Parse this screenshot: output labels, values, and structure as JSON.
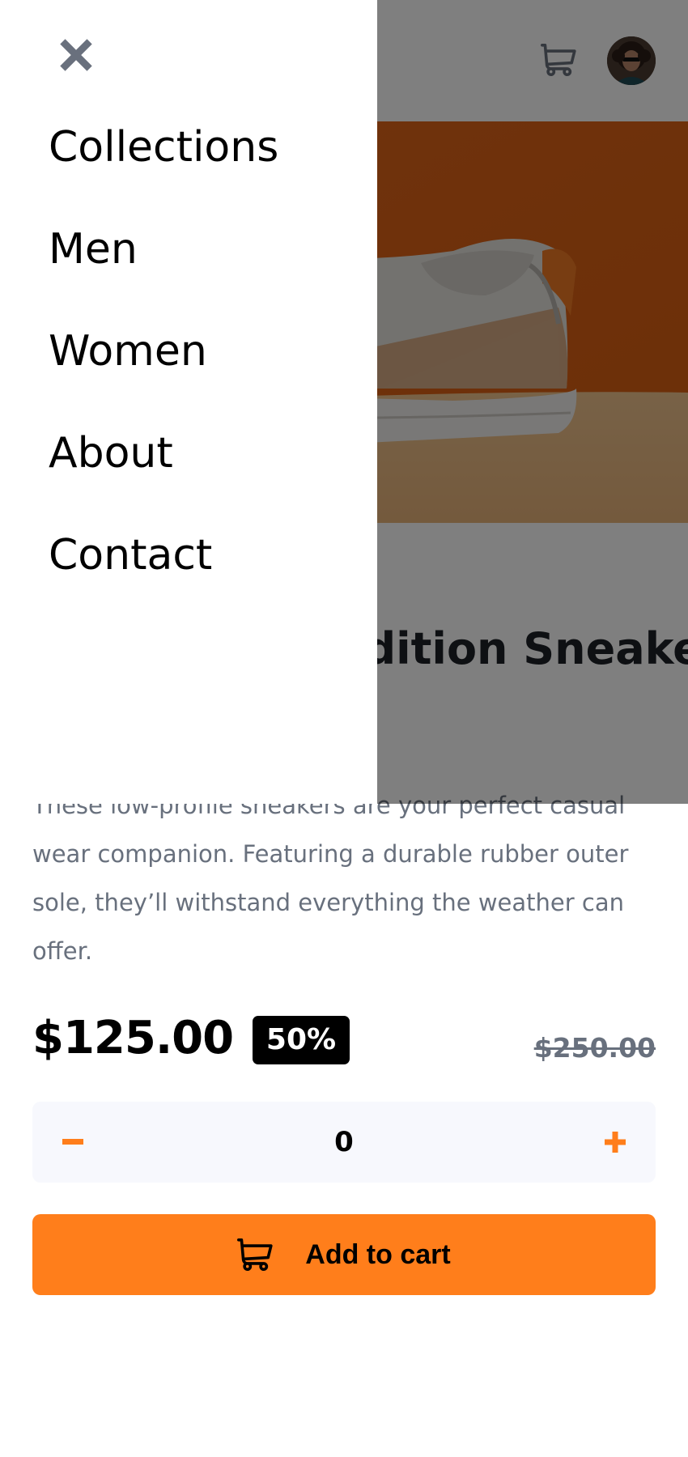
{
  "header": {
    "cart_icon": "cart-icon",
    "avatar_icon": "user-avatar"
  },
  "product": {
    "title": "Fall Limited Edition Sneakers",
    "description": "These low-profile sneakers are your perfect casual wear companion. Featuring a durable rubber outer sole, they’ll withstand everything the weather can offer.",
    "price": "$125.00",
    "discount": "50%",
    "original_price": "$250.00",
    "image_icon": "sneaker-photo"
  },
  "quantity": {
    "value": "0",
    "minus_icon": "minus-icon",
    "plus_icon": "plus-icon"
  },
  "add_to_cart": {
    "label": "Add to cart",
    "icon": "cart-icon"
  },
  "menu": {
    "close_icon": "close-icon",
    "items": [
      "Collections",
      "Men",
      "Women",
      "About",
      "Contact"
    ]
  },
  "colors": {
    "accent": "#ff7e1b",
    "text_dark": "#1d2026",
    "text_muted": "#68707d",
    "stepper_bg": "#f7f8fd",
    "overlay": "rgba(0,0,0,0.5)"
  }
}
